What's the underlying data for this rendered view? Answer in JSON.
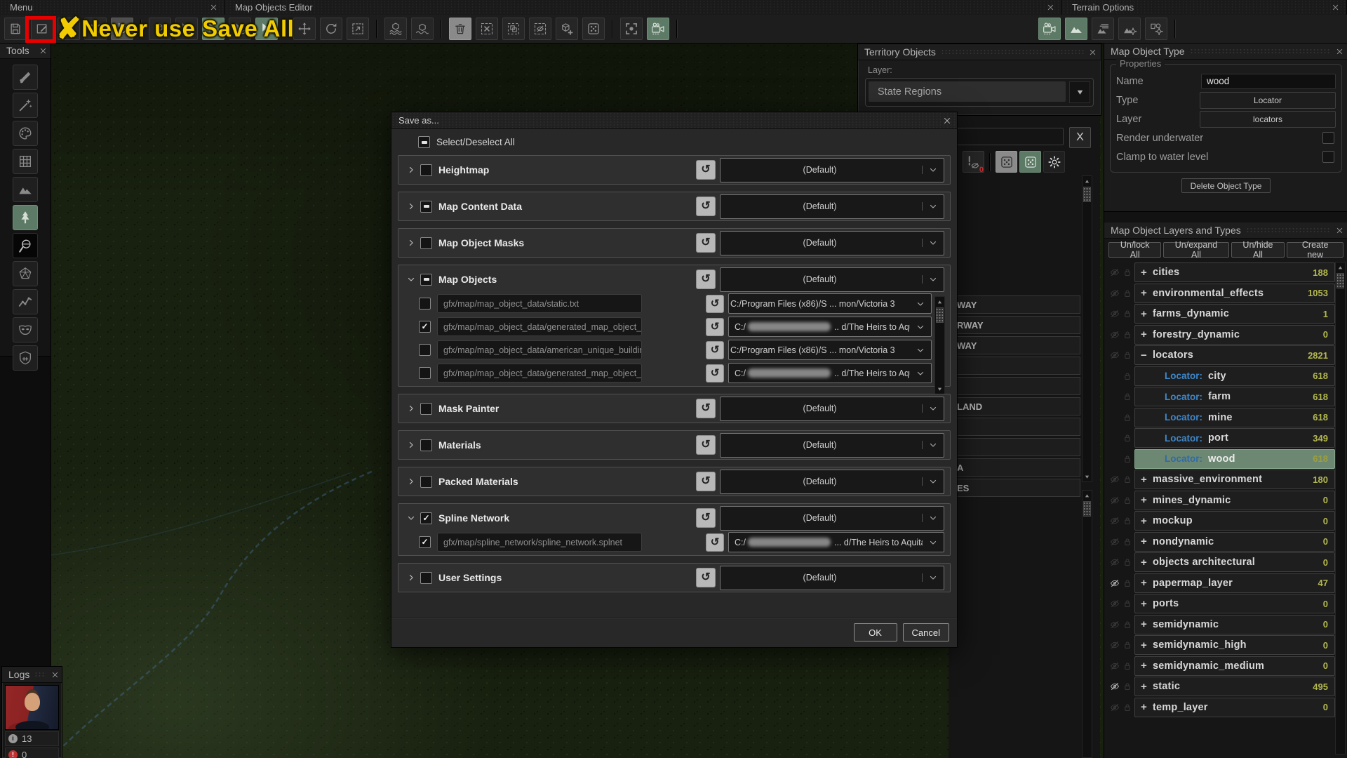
{
  "colors": {
    "accent_green": "#5d7a66",
    "count_olive": "#b3b84e",
    "locator_blue": "#3f87c9",
    "warning_yellow": "#f2cc00",
    "highlight_red": "#e60000"
  },
  "tabs": {
    "menu": "Menu",
    "map_objects_editor": "Map Objects Editor",
    "terrain_options": "Terrain Options"
  },
  "annotation": {
    "x_mark": "✘",
    "text": "Never use Save All"
  },
  "toolbar": {
    "left": [
      {
        "name": "save",
        "sym": "floppy"
      },
      {
        "name": "save-all",
        "sym": "edit",
        "red_box": true
      },
      {
        "name": "export-document",
        "sym": "doc"
      },
      {
        "name": "settings",
        "sym": "gear"
      },
      {
        "name": "undo",
        "sym": "undo",
        "variant": "pressed"
      },
      {
        "sep": true
      },
      {
        "name": "add-object",
        "sym": "cube-plus"
      },
      {
        "name": "select",
        "sym": "cursor-x"
      },
      {
        "name": "select-objects",
        "sym": "cursor-cube",
        "variant": "green"
      },
      {
        "name": "pick-vegetation",
        "sym": "cursor-leaf"
      },
      {
        "name": "place-object",
        "sym": "cursor-cube",
        "variant": "green"
      },
      {
        "sep": true
      },
      {
        "name": "move-object",
        "sym": "move"
      },
      {
        "name": "rotate-object",
        "sym": "rotate"
      },
      {
        "name": "scale-object",
        "sym": "scale"
      },
      {
        "sep": true
      },
      {
        "name": "float-object",
        "sym": "cube-waves"
      },
      {
        "name": "sink-object",
        "sym": "cube-sink"
      },
      {
        "sep": true
      },
      {
        "name": "delete-object",
        "sym": "trash",
        "variant": "gray"
      },
      {
        "name": "selection-delete",
        "sym": "frame-x"
      },
      {
        "name": "selection-duplicate",
        "sym": "frame-copy"
      },
      {
        "name": "selection-hide",
        "sym": "frame-eye"
      },
      {
        "name": "selection-add",
        "sym": "cube-plus"
      },
      {
        "name": "randomize",
        "sym": "dice"
      },
      {
        "sep": true
      },
      {
        "name": "focus-camera",
        "sym": "target"
      },
      {
        "name": "camera-mode",
        "sym": "camera",
        "variant": "green"
      },
      {
        "sep": true
      }
    ],
    "right": [
      {
        "name": "camera-settings",
        "sym": "camera",
        "variant": "green"
      },
      {
        "name": "terrain-view",
        "sym": "mountain",
        "variant": "green"
      },
      {
        "name": "terrain-layers",
        "sym": "mountain-lines"
      },
      {
        "name": "terrain-generation",
        "sym": "mountain-gear"
      },
      {
        "name": "objects-settings",
        "sym": "shapes-gear"
      },
      {
        "sep": true
      }
    ]
  },
  "tools": {
    "title": "Tools",
    "items": [
      {
        "name": "paint-brush",
        "sym": "brush"
      },
      {
        "name": "detail-brush",
        "sym": "wand"
      },
      {
        "name": "materials-palette",
        "sym": "palette"
      },
      {
        "name": "texture-grid",
        "sym": "grid"
      },
      {
        "name": "terrain-sculpt",
        "sym": "mountain"
      },
      {
        "name": "map-objects-tool",
        "sym": "tree",
        "variant": "green"
      },
      {
        "name": "sphere-paint",
        "sym": "sphere-brush",
        "variant": "black"
      },
      {
        "name": "geometry-wireframe",
        "sym": "wireframe"
      },
      {
        "name": "spline-tool",
        "sym": "spline"
      },
      {
        "name": "mask-tool",
        "sym": "mask"
      },
      {
        "name": "game-mode",
        "sym": "shield"
      }
    ]
  },
  "territory": {
    "title": "Territory Objects",
    "layer_label": "Layer:",
    "layer_value": "State Regions"
  },
  "background_panel": {
    "clear_label": "X",
    "rows": [
      "WAY",
      "RWAY",
      "WAY",
      "",
      "",
      "LAND",
      "",
      "",
      "A",
      "ES"
    ]
  },
  "dialog": {
    "title": "Save as...",
    "select_all_label": "Select/Deselect All",
    "reset_glyph": "↺",
    "ok": "OK",
    "cancel": "Cancel",
    "sections": [
      {
        "label": "Heightmap",
        "checkbox": "un",
        "expanded": false,
        "value": "(Default)"
      },
      {
        "label": "Map Content Data",
        "checkbox": "partial",
        "expanded": false,
        "value": "(Default)"
      },
      {
        "label": "Map Object Masks",
        "checkbox": "un",
        "expanded": false,
        "value": "(Default)"
      },
      {
        "label": "Map Objects",
        "checkbox": "partial",
        "expanded": true,
        "value": "(Default)",
        "scrollbar": true,
        "rows": [
          {
            "checked": false,
            "path": "gfx/map/map_object_data/static.txt",
            "dest": {
              "text": "C:/Program Files (x86)/S ... mon/Victoria 3"
            }
          },
          {
            "checked": true,
            "path": "gfx/map/map_object_data/generated_map_object_loc",
            "dest": {
              "prefix": "C:/",
              "redacted": true,
              "suffix": ".. d/The Heirs to Aquitania"
            }
          },
          {
            "checked": false,
            "path": "gfx/map/map_object_data/american_unique_building",
            "dest": {
              "text": "C:/Program Files (x86)/S ... mon/Victoria 3"
            }
          },
          {
            "checked": false,
            "path": "gfx/map/map_object_data/generated_map_object_loc",
            "dest": {
              "prefix": "C:/",
              "redacted": true,
              "suffix": ".. d/The Heirs to Aquitania"
            }
          }
        ]
      },
      {
        "label": "Mask Painter",
        "checkbox": "un",
        "expanded": false,
        "value": "(Default)"
      },
      {
        "label": "Materials",
        "checkbox": "un",
        "expanded": false,
        "value": "(Default)"
      },
      {
        "label": "Packed Materials",
        "checkbox": "un",
        "expanded": false,
        "value": "(Default)"
      },
      {
        "label": "Spline Network",
        "checkbox": "checked",
        "expanded": true,
        "value": "(Default)",
        "rows": [
          {
            "checked": true,
            "path": "gfx/map/spline_network/spline_network.splnet",
            "dest": {
              "prefix": "C:/",
              "redacted": true,
              "suffix": "... d/The Heirs to Aquitania"
            }
          }
        ]
      },
      {
        "label": "User Settings",
        "checkbox": "un",
        "expanded": false,
        "value": "(Default)"
      }
    ]
  },
  "object_type": {
    "title": "Map Object Type",
    "group_label": "Properties",
    "name_label": "Name",
    "name_value": "wood",
    "type_label": "Type",
    "type_value": "Locator",
    "layer_label": "Layer",
    "layer_value": "locators",
    "render_underwater_label": "Render underwater",
    "clamp_label": "Clamp to water level",
    "delete_button": "Delete Object Type"
  },
  "layers_panel": {
    "title": "Map Object Layers and Types",
    "buttons": [
      "Un/lock All",
      "Un/expand All",
      "Un/hide All",
      "Create new"
    ],
    "items": [
      {
        "label": "cities",
        "count": "188",
        "expand": "+"
      },
      {
        "label": "environmental_effects",
        "count": "1053",
        "expand": "+"
      },
      {
        "label": "farms_dynamic",
        "count": "1",
        "expand": "+"
      },
      {
        "label": "forestry_dynamic",
        "count": "0",
        "expand": "+"
      },
      {
        "label": "locators",
        "count": "2821",
        "expand": "−"
      },
      {
        "type": "Locator:",
        "label": "city",
        "count": "618",
        "child": true
      },
      {
        "type": "Locator:",
        "label": "farm",
        "count": "618",
        "child": true
      },
      {
        "type": "Locator:",
        "label": "mine",
        "count": "618",
        "child": true
      },
      {
        "type": "Locator:",
        "label": "port",
        "count": "349",
        "child": true
      },
      {
        "type": "Locator:",
        "label": "wood",
        "count": "618",
        "child": true,
        "selected": true
      },
      {
        "label": "massive_environment",
        "count": "180",
        "expand": "+"
      },
      {
        "label": "mines_dynamic",
        "count": "0",
        "expand": "+"
      },
      {
        "label": "mockup",
        "count": "0",
        "expand": "+"
      },
      {
        "label": "nondynamic",
        "count": "0",
        "expand": "+"
      },
      {
        "label": "objects architectural",
        "count": "0",
        "expand": "+"
      },
      {
        "label": "papermap_layer",
        "count": "47",
        "expand": "+",
        "hidden_eye": true
      },
      {
        "label": "ports",
        "count": "0",
        "expand": "+"
      },
      {
        "label": "semidynamic",
        "count": "0",
        "expand": "+"
      },
      {
        "label": "semidynamic_high",
        "count": "0",
        "expand": "+"
      },
      {
        "label": "semidynamic_medium",
        "count": "0",
        "expand": "+"
      },
      {
        "label": "static",
        "count": "495",
        "expand": "+",
        "hidden_eye": true
      },
      {
        "label": "temp_layer",
        "count": "0",
        "expand": "+"
      }
    ]
  },
  "logs": {
    "title": "Logs",
    "info_glyph": "i",
    "error_glyph": "!",
    "info_count": "13",
    "error_count": "0"
  }
}
